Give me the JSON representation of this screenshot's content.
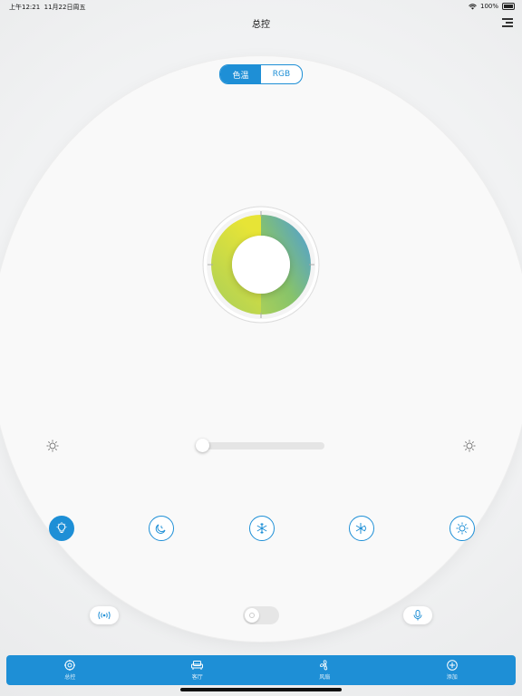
{
  "status_bar": {
    "time": "上午12:21",
    "date": "11月22日周五",
    "battery": "100%"
  },
  "nav": {
    "title": "总控"
  },
  "segment": {
    "options": [
      "色温",
      "RGB"
    ],
    "selected": "色温"
  },
  "color_wheel": {
    "gradient_colors": [
      "#4a9be0",
      "#87c36a",
      "#e7e436"
    ]
  },
  "brightness_slider": {
    "value": 0
  },
  "modes": [
    {
      "icon": "bulb-icon",
      "active": true
    },
    {
      "icon": "moon-clock-icon",
      "active": false
    },
    {
      "icon": "snowflake-icon",
      "active": false
    },
    {
      "icon": "snowflake-sun-icon",
      "active": false
    },
    {
      "icon": "sun-icon",
      "active": false
    }
  ],
  "bottom_controls": {
    "left_icon": "broadcast-icon",
    "toggle_on": false,
    "right_icon": "microphone-icon"
  },
  "tabbar": {
    "tabs": [
      {
        "label": "总控",
        "icon": "target-icon"
      },
      {
        "label": "客厅",
        "icon": "sofa-icon"
      },
      {
        "label": "风扇",
        "icon": "fan-icon"
      },
      {
        "label": "添加",
        "icon": "plus-circle-icon"
      }
    ]
  },
  "colors": {
    "accent": "#1e8fd6"
  }
}
